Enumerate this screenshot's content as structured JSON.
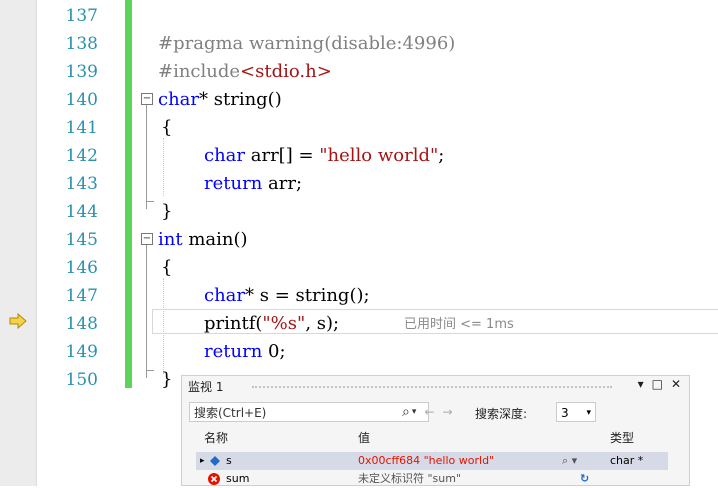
{
  "editor": {
    "line_numbers": [
      "137",
      "138",
      "139",
      "140",
      "141",
      "142",
      "143",
      "144",
      "145",
      "146",
      "147",
      "148",
      "149",
      "150"
    ],
    "code": {
      "l138": {
        "text": "#pragma warning(disable:4996)"
      },
      "l139": {
        "pre": "#include",
        "inc": "<stdio.h>"
      },
      "l140": {
        "kw": "char",
        "rest": "* string()"
      },
      "l141": "{",
      "l142": {
        "kw": "char",
        "mid": " arr[] = ",
        "str": "\"hello world\"",
        "end": ";"
      },
      "l143": {
        "kw": "return",
        "rest": " arr;"
      },
      "l144": "}",
      "l145": {
        "kw": "int",
        "rest": " main()"
      },
      "l146": "{",
      "l147": {
        "kw": "char",
        "rest": "* s = string();"
      },
      "l148": {
        "fn": "printf(",
        "str": "\"%s\"",
        "rest": ", s);"
      },
      "l149": {
        "kw": "return",
        "rest": " 0;"
      },
      "l150": "}"
    },
    "elapsed_text": "已用时间 <= 1ms",
    "fold_collapse_symbol": "−"
  },
  "watch": {
    "title": "监视 1",
    "controls": {
      "dropdown": "▾",
      "maximize": "□",
      "close": "✕"
    },
    "search_placeholder": "搜索(Ctrl+E)",
    "search_icon": "⌕",
    "search_icon_drop": "▾",
    "nav_back": "←",
    "nav_forward": "→",
    "depth_label": "搜索深度:",
    "depth_value": "3",
    "depth_drop": "▾",
    "columns": {
      "name": "名称",
      "value": "值",
      "type": "类型"
    },
    "rows": [
      {
        "expand": "▸",
        "name": "s",
        "value": "0x00cff684 \"hello world\"",
        "tools": "⌕ ▾",
        "type": "char *"
      },
      {
        "name": "sum",
        "value": "未定义标识符 \"sum\"",
        "tools": "↻",
        "type": ""
      }
    ]
  },
  "colors": {
    "keyword": "#0000ff",
    "string": "#a31515",
    "preprocessor": "#808080",
    "line_number": "#2b91af",
    "change_bar": "#5dd35d",
    "error": "#e51400"
  }
}
